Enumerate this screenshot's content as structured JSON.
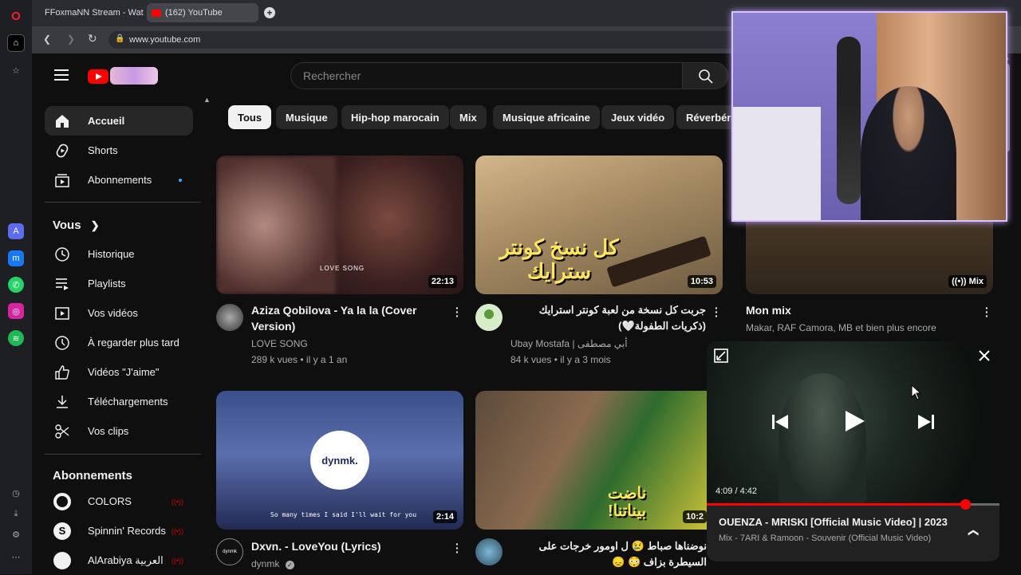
{
  "browser": {
    "tabs": [
      {
        "label": "FFoxmaNN Stream - Watc"
      },
      {
        "label": "(162) YouTube"
      }
    ],
    "url": "www.youtube.com"
  },
  "header": {
    "search_placeholder": "Rechercher"
  },
  "sidebar": {
    "main": [
      {
        "label": "Accueil",
        "icon": "home-icon"
      },
      {
        "label": "Shorts",
        "icon": "shorts-icon"
      },
      {
        "label": "Abonnements",
        "icon": "subscriptions-icon"
      }
    ],
    "you_heading": "Vous",
    "you": [
      {
        "label": "Historique",
        "icon": "history-icon"
      },
      {
        "label": "Playlists",
        "icon": "playlists-icon"
      },
      {
        "label": "Vos vidéos",
        "icon": "your-videos-icon"
      },
      {
        "label": "À regarder plus tard",
        "icon": "watch-later-icon"
      },
      {
        "label": "Vidéos \"J'aime\"",
        "icon": "thumbs-up-icon"
      },
      {
        "label": "Téléchargements",
        "icon": "download-icon"
      },
      {
        "label": "Vos clips",
        "icon": "scissors-icon"
      }
    ],
    "subs_heading": "Abonnements",
    "subs": [
      {
        "label": "COLORS"
      },
      {
        "label": "Spinnin' Records"
      },
      {
        "label": "AlArabiya العربية"
      }
    ]
  },
  "chips": [
    "Tous",
    "Musique",
    "Hip-hop marocain",
    "Mix",
    "Musique africaine",
    "Jeux vidéo",
    "Réverbéra"
  ],
  "videos": [
    {
      "title": "Aziza Qobilova - Ya la la (Cover Version)",
      "channel": "LOVE SONG",
      "meta": "289 k vues • il y a 1 an",
      "duration": "22:13",
      "overlay": "LOVE SONG"
    },
    {
      "title": "جربت كل نسخة من لعبة كونتر استرايك (ذكريات الطفولة🤍)",
      "channel": "Ubay Mostafa | أبي مصطفى",
      "meta": "84 k vues • il y a 3 mois",
      "duration": "10:53",
      "overlay": "كل نسخ كونتر سترايك"
    },
    {
      "title": "Mon mix",
      "channel": "Makar, RAF Camora, MB et bien plus encore",
      "meta": "",
      "duration": "Mix",
      "overlay": ""
    },
    {
      "title": "Dxvn. - LoveYou (Lyrics)",
      "channel": "dynmk",
      "meta": "",
      "duration": "2:14",
      "overlay": "dynmk.",
      "caption": "So many times I said I'll wait for you"
    },
    {
      "title": "نوضناها صباط 😢 ل اومور خرجات على السيطرة بزاف 😳 😞",
      "channel": "",
      "meta": "",
      "duration": "10:2",
      "overlay": "ناضت بيناتنا!"
    }
  ],
  "miniplayer": {
    "time": "4:09 / 4:42",
    "progress": 0.883,
    "title": "OUENZA - MRISKI [Official Music Video] | 2023",
    "subtitle": "Mix - 7ARI & Ramoon - Souvenir (Official Music Video)"
  },
  "colors": {
    "accent": "#ff0000",
    "chip_selected": "#f1f1f1",
    "background": "#0f0f0f"
  }
}
